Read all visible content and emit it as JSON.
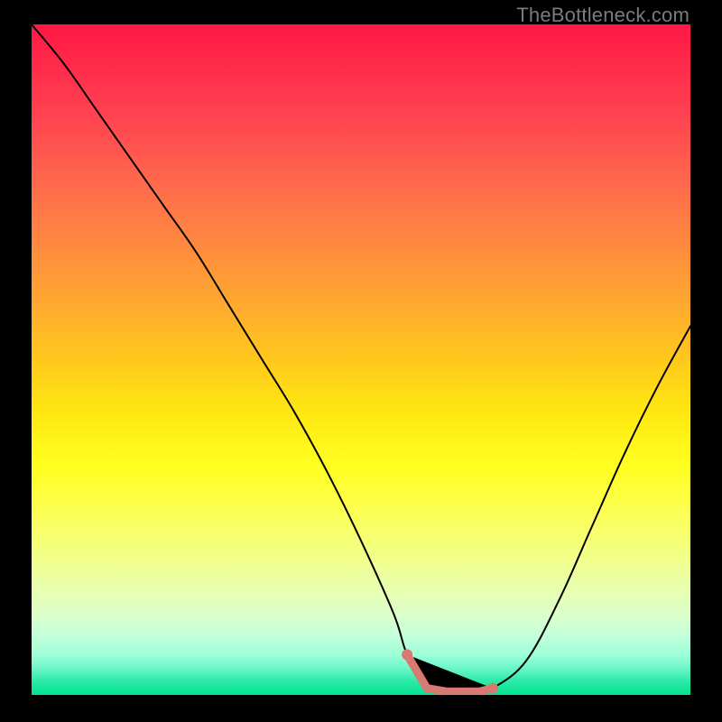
{
  "watermark": "TheBottleneck.com",
  "chart_data": {
    "type": "line",
    "title": "",
    "xlabel": "",
    "ylabel": "",
    "xlim": [
      0,
      100
    ],
    "ylim": [
      0,
      100
    ],
    "grid": false,
    "legend": false,
    "x": [
      0,
      5,
      10,
      15,
      20,
      25,
      30,
      35,
      40,
      45,
      50,
      55,
      57,
      60,
      63,
      66,
      68,
      70,
      75,
      80,
      85,
      90,
      95,
      100
    ],
    "values": [
      100,
      94,
      87,
      80,
      73,
      66,
      58,
      50,
      42,
      33,
      23,
      12,
      6,
      1,
      0.5,
      0.5,
      0.5,
      1,
      5,
      14,
      25,
      36,
      46,
      55
    ],
    "highlight_range_x": [
      57,
      70
    ],
    "annotations": []
  },
  "colors": {
    "curve": "#000000",
    "highlight": "#d97a72"
  }
}
